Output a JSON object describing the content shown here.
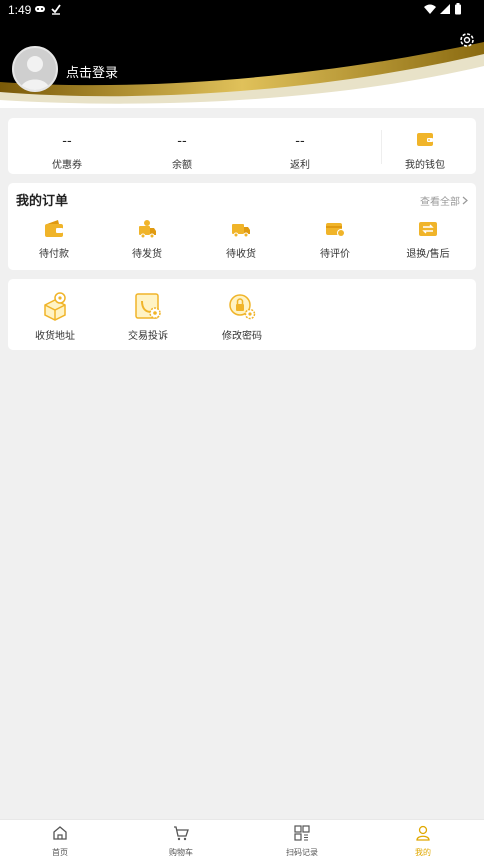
{
  "status_bar": {
    "time": "1:49"
  },
  "header": {
    "login_text": "点击登录"
  },
  "stats": {
    "items": [
      {
        "value": "--",
        "label": "优惠券"
      },
      {
        "value": "--",
        "label": "余额"
      },
      {
        "value": "--",
        "label": "返利"
      }
    ],
    "wallet_label": "我的钱包"
  },
  "orders": {
    "title": "我的订单",
    "view_all": "查看全部",
    "items": [
      {
        "label": "待付款",
        "icon": "wallet-icon"
      },
      {
        "label": "待发货",
        "icon": "delivery-icon"
      },
      {
        "label": "待收货",
        "icon": "truck-icon"
      },
      {
        "label": "待评价",
        "icon": "review-icon"
      },
      {
        "label": "退换/售后",
        "icon": "exchange-icon"
      }
    ]
  },
  "tools": {
    "items": [
      {
        "label": "收货地址",
        "icon": "address-icon"
      },
      {
        "label": "交易投诉",
        "icon": "complaint-icon"
      },
      {
        "label": "修改密码",
        "icon": "password-icon"
      }
    ]
  },
  "tabbar": {
    "items": [
      {
        "label": "首页",
        "icon": "home-icon"
      },
      {
        "label": "购物车",
        "icon": "cart-icon"
      },
      {
        "label": "扫码记录",
        "icon": "scan-record-icon"
      },
      {
        "label": "我的",
        "icon": "user-icon",
        "active": true
      }
    ]
  },
  "colors": {
    "accent": "#f0b429",
    "header_bg": "#000000",
    "active_tab": "#e0a800"
  }
}
